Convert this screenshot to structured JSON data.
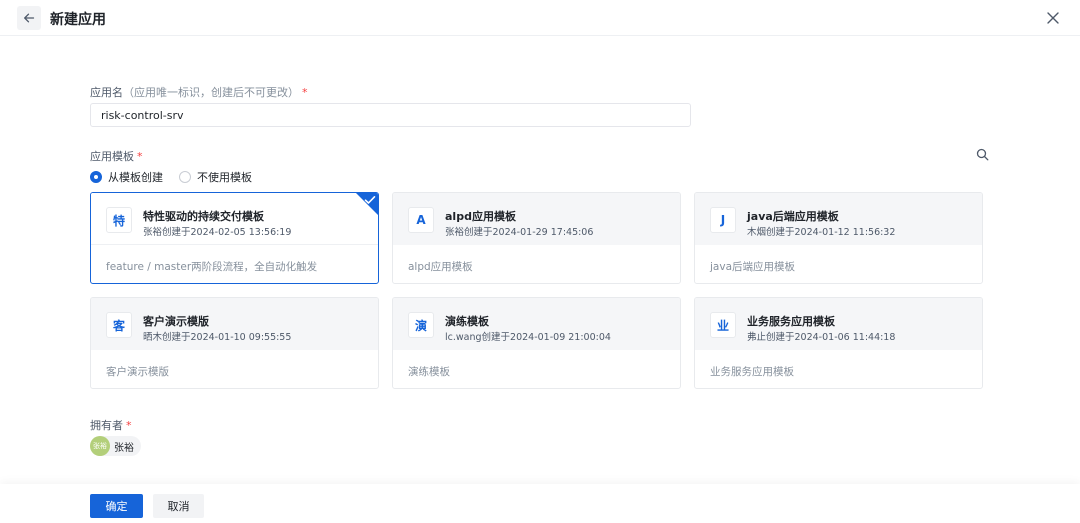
{
  "header": {
    "title": "新建应用",
    "back_icon": "arrow-left-icon",
    "close_icon": "close-icon"
  },
  "form": {
    "app_name": {
      "label": "应用名",
      "hint": "（应用唯一标识，创建后不可更改）",
      "required_mark": "*",
      "value": "risk-control-srv"
    },
    "template": {
      "label": "应用模板",
      "required_mark": "*",
      "search_icon": "search-icon",
      "options": [
        {
          "label": "从模板创建",
          "checked": true
        },
        {
          "label": "不使用模板",
          "checked": false
        }
      ],
      "cards": [
        {
          "icon_char": "特",
          "name": "特性驱动的持续交付模板",
          "meta": "张裕创建于2024-02-05 13:56:19",
          "desc": "feature / master两阶段流程，全自动化触发",
          "selected": true
        },
        {
          "icon_char": "A",
          "name": "alpd应用模板",
          "meta": "张裕创建于2024-01-29 17:45:06",
          "desc": "alpd应用模板",
          "selected": false
        },
        {
          "icon_char": "J",
          "name": "java后端应用模板",
          "meta": "木烟创建于2024-01-12 11:56:32",
          "desc": "java后端应用模板",
          "selected": false
        },
        {
          "icon_char": "客",
          "name": "客户演示模版",
          "meta": "晒木创建于2024-01-10 09:55:55",
          "desc": "客户演示模版",
          "selected": false
        },
        {
          "icon_char": "演",
          "name": "演练模板",
          "meta": "lc.wang创建于2024-01-09 21:00:04",
          "desc": "演练模板",
          "selected": false
        },
        {
          "icon_char": "业",
          "name": "业务服务应用模板",
          "meta": "弗止创建于2024-01-06 11:44:18",
          "desc": "业务服务应用模板",
          "selected": false
        }
      ]
    },
    "owner": {
      "label": "拥有者",
      "required_mark": "*",
      "avatar_text": "张裕",
      "name": "张裕"
    }
  },
  "footer": {
    "confirm_label": "确定",
    "cancel_label": "取消"
  },
  "colors": {
    "primary": "#1664d9",
    "required": "#f53f3f"
  }
}
